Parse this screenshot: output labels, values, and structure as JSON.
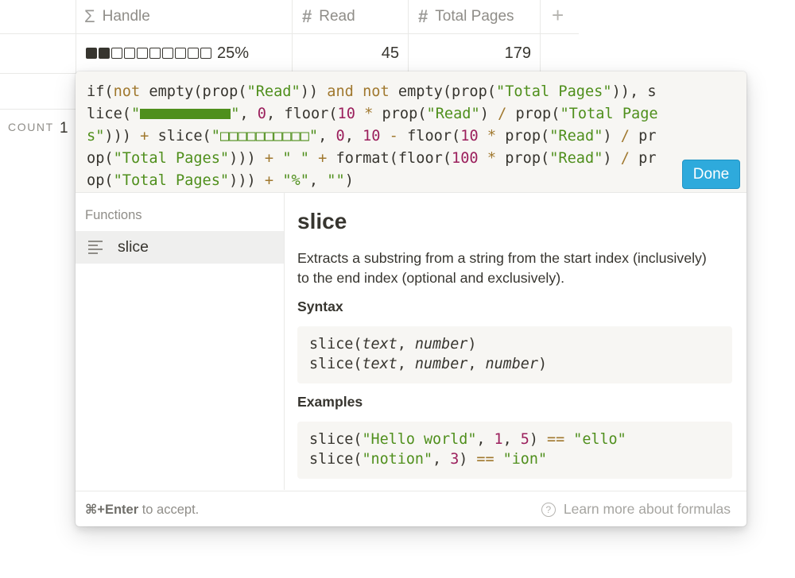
{
  "table": {
    "columns": [
      {
        "icon": "sigma-icon",
        "glyph": "Σ",
        "label": "Handle"
      },
      {
        "icon": "number-icon",
        "glyph": "#",
        "label": "Read"
      },
      {
        "icon": "number-icon",
        "glyph": "#",
        "label": "Total Pages"
      }
    ],
    "add_column_glyph": "+",
    "row": {
      "progress_filled": 2,
      "progress_total": 10,
      "progress_text": "25%",
      "read": "45",
      "total_pages": "179"
    },
    "count_label": "COUNT",
    "count_value": "1"
  },
  "popup": {
    "formula": {
      "read_prop": "\"Read\"",
      "total_prop_1": "\"Total Pages\"",
      "total_prop_2a": "\"Total",
      "total_prop_2b": "Pages\"",
      "empty_boxes": "\"□□□□□□□□□□\"",
      "space_str": "\" \"",
      "percent_str": "\"%\"",
      "empty_str": "\"\"",
      "n0": "0",
      "n10": "10",
      "n100": "100"
    },
    "done_label": "Done",
    "functions_heading": "Functions",
    "function_item": "slice",
    "doc": {
      "title": "slice",
      "description": "Extracts a substring from a string from the start index (inclusively) to the end index (optional and exclusively).",
      "syntax_heading": "Syntax",
      "syntax_fn": "slice",
      "syntax_text": "text",
      "syntax_number": "number",
      "examples_heading": "Examples",
      "ex1_str": "\"Hello world\"",
      "ex1_a": "1",
      "ex1_b": "5",
      "ex1_result": "\"ello\"",
      "ex2_str": "\"notion\"",
      "ex2_a": "3",
      "ex2_result": "\"ion\""
    },
    "footer_key": "⌘+Enter",
    "footer_rest": " to accept.",
    "help_glyph": "?",
    "help_label": "Learn more about formulas"
  },
  "colors": {
    "accent": "#2eaadc",
    "string": "#4f8f1c",
    "number": "#9b1f5c",
    "keyword": "#a0782e"
  }
}
